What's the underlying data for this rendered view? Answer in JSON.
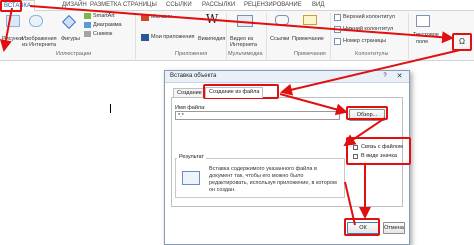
{
  "ribbon": {
    "tabs": [
      "ВСТАВКА",
      "ДИЗАЙН",
      "РАЗМЕТКА СТРАНИЦЫ",
      "ССЫЛКИ",
      "РАССЫЛКИ",
      "РЕЦЕНЗИРОВАНИЕ",
      "ВИД"
    ],
    "active_tab": "ВСТАВКА",
    "buttons": {
      "pictures": "Рисунки",
      "online_pictures": "Изображения из Интернета",
      "shapes": "Фигуры",
      "smartart": "SmartArt",
      "chart": "Диаграмма",
      "screenshot": "Снимок",
      "store": "Магазин",
      "my_apps": "Мои приложения",
      "wikipedia": "Википедия",
      "online_video": "Видео из Интернета",
      "links": "Ссылки",
      "comment": "Примечание",
      "header": "Верхний колонтитул",
      "footer": "Нижний колонтитул",
      "page_number": "Номер страницы",
      "text_box_1": "Текстовое",
      "text_box_2": "поле"
    },
    "groups": {
      "illustrations": "Иллюстрации",
      "apps": "Приложения",
      "media": "Мультимедиа",
      "comments": "Примечания",
      "header_footer": "Колонтитулы"
    },
    "icons": {
      "store": "shopping-bag-icon",
      "wikipedia": "wikipedia-w-icon",
      "object_button": "omega-object-icon"
    }
  },
  "dialog": {
    "title": "Вставка объекта",
    "help": "?",
    "close": "✕",
    "tabs": [
      "Создание",
      "Создание из файла"
    ],
    "active_tab": "Создание из файла",
    "file_name_label": "Имя файла:",
    "file_name_value": "*.*",
    "browse_button": "Обзор...",
    "link_checkbox": "Связь с файлом",
    "icon_checkbox": "В виде значка",
    "result_label": "Результат",
    "result_text": "Вставка содержимого указанного файла в документ так, чтобы его можно было редактировать, используя приложение, в котором он создан.",
    "ok_button": "ОК",
    "cancel_button": "Отмена"
  },
  "annotations": {
    "color": "#e01010"
  }
}
